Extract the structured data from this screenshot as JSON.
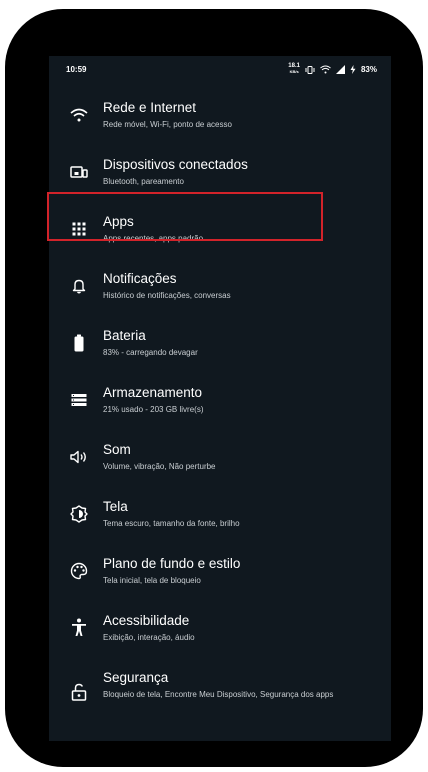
{
  "status_bar": {
    "time": "10:59",
    "speed_value": "18.1",
    "speed_unit": "KB/s",
    "battery": "83%"
  },
  "settings_items": [
    {
      "title": "Rede e Internet",
      "subtitle": "Rede móvel, Wi-Fi, ponto de acesso",
      "icon": "wifi-icon"
    },
    {
      "title": "Dispositivos conectados",
      "subtitle": "Bluetooth, pareamento",
      "icon": "connected-devices-icon"
    },
    {
      "title": "Apps",
      "subtitle": "Apps recentes, apps padrão",
      "icon": "apps-grid-icon",
      "highlighted": true
    },
    {
      "title": "Notificações",
      "subtitle": "Histórico de notificações, conversas",
      "icon": "bell-icon"
    },
    {
      "title": "Bateria",
      "subtitle": "83% - carregando devagar",
      "icon": "battery-icon"
    },
    {
      "title": "Armazenamento",
      "subtitle": "21% usado - 203 GB livre(s)",
      "icon": "storage-icon"
    },
    {
      "title": "Som",
      "subtitle": "Volume, vibração, Não perturbe",
      "icon": "speaker-icon"
    },
    {
      "title": "Tela",
      "subtitle": "Tema escuro, tamanho da fonte, brilho",
      "icon": "brightness-icon"
    },
    {
      "title": "Plano de fundo e estilo",
      "subtitle": "Tela inicial, tela de bloqueio",
      "icon": "palette-icon"
    },
    {
      "title": "Acessibilidade",
      "subtitle": "Exibição, interação, áudio",
      "icon": "accessibility-icon"
    },
    {
      "title": "Segurança",
      "subtitle": "Bloqueio de tela, Encontre Meu Dispositivo, Segurança dos apps",
      "icon": "lock-icon"
    }
  ],
  "colors": {
    "screen_background": "#10181f",
    "highlight_border": "#d2232a",
    "text_primary": "#ffffff",
    "text_secondary": "#c9ced2"
  }
}
